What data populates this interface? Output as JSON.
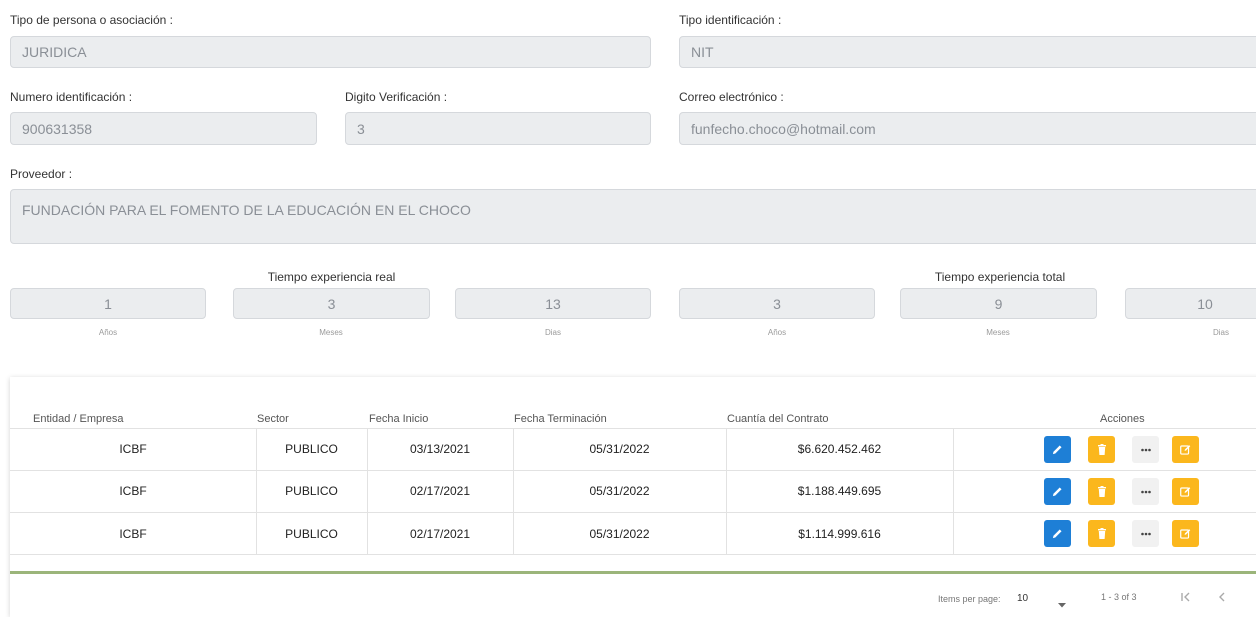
{
  "form": {
    "tipo_persona": {
      "label": "Tipo de persona o asociación :",
      "value": "JURIDICA"
    },
    "tipo_identificacion": {
      "label": "Tipo identificación :",
      "value": "NIT"
    },
    "numero_identificacion": {
      "label": "Numero identificación :",
      "value": "900631358"
    },
    "digito_verificacion": {
      "label": "Digito Verificación :",
      "value": "3"
    },
    "correo": {
      "label": "Correo electrónico :",
      "value": "funfecho.choco@hotmail.com"
    },
    "proveedor": {
      "label": "Proveedor :",
      "value": "FUNDACIÓN PARA EL FOMENTO DE LA EDUCACIÓN EN EL CHOCO"
    }
  },
  "experiencia": {
    "real": {
      "title": "Tiempo experiencia real",
      "anios": "1",
      "meses": "3",
      "dias": "13"
    },
    "total": {
      "title": "Tiempo experiencia total",
      "anios": "3",
      "meses": "9",
      "dias": "10"
    },
    "units": {
      "anios": "Años",
      "meses": "Meses",
      "dias": "Dias"
    }
  },
  "table": {
    "headers": {
      "entidad": "Entidad / Empresa",
      "sector": "Sector",
      "fecha_inicio": "Fecha Inicio",
      "fecha_terminacion": "Fecha Terminación",
      "cuantia": "Cuantía del Contrato",
      "acciones": "Acciones"
    },
    "rows": [
      {
        "entidad": "ICBF",
        "sector": "PUBLICO",
        "fecha_inicio": "03/13/2021",
        "fecha_terminacion": "05/31/2022",
        "cuantia": "$6.620.452.462"
      },
      {
        "entidad": "ICBF",
        "sector": "PUBLICO",
        "fecha_inicio": "02/17/2021",
        "fecha_terminacion": "05/31/2022",
        "cuantia": "$1.188.449.695"
      },
      {
        "entidad": "ICBF",
        "sector": "PUBLICO",
        "fecha_inicio": "02/17/2021",
        "fecha_terminacion": "05/31/2022",
        "cuantia": "$1.114.999.616"
      }
    ],
    "action_icons": [
      "pencil-icon",
      "trash-icon",
      "ellipsis-icon",
      "edit-square-icon"
    ]
  },
  "paginator": {
    "items_per_page_label": "Items per page:",
    "items_per_page_value": "10",
    "range_label": "1 - 3 of 3"
  },
  "colors": {
    "primary_button": "#1e7fd6",
    "warning_button": "#fbb71d",
    "divider_accent": "#9bb57a"
  }
}
